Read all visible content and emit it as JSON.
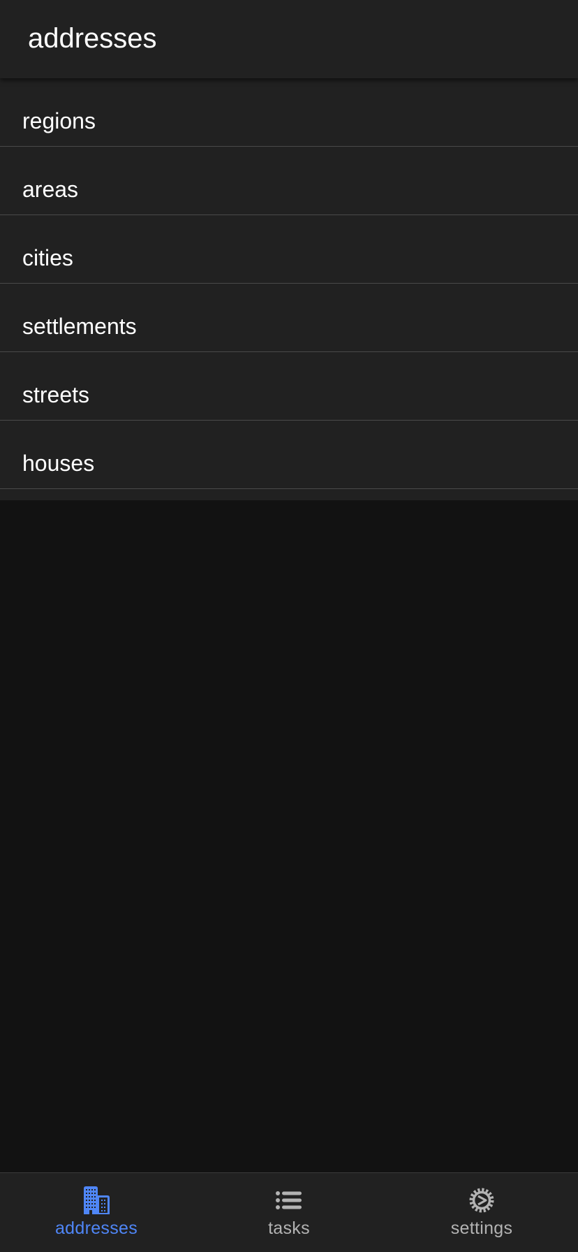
{
  "header": {
    "title": "addresses"
  },
  "list": {
    "items": [
      {
        "label": "regions"
      },
      {
        "label": "areas"
      },
      {
        "label": "cities"
      },
      {
        "label": "settlements"
      },
      {
        "label": "streets"
      },
      {
        "label": "houses"
      }
    ]
  },
  "bottom_nav": {
    "active_color": "#4f86f7",
    "inactive_color": "#b3b3b3",
    "tabs": [
      {
        "label": "addresses",
        "icon": "buildings-icon",
        "active": true
      },
      {
        "label": "tasks",
        "icon": "list-icon",
        "active": false
      },
      {
        "label": "settings",
        "icon": "gear-icon",
        "active": false
      }
    ]
  }
}
